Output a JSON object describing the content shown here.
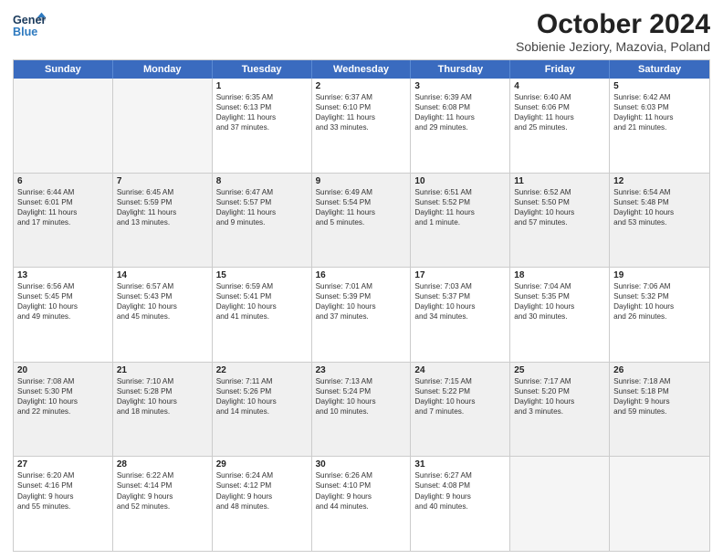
{
  "header": {
    "logo_line1": "General",
    "logo_line2": "Blue",
    "title": "October 2024",
    "subtitle": "Sobienie Jeziory, Mazovia, Poland"
  },
  "days": [
    "Sunday",
    "Monday",
    "Tuesday",
    "Wednesday",
    "Thursday",
    "Friday",
    "Saturday"
  ],
  "weeks": [
    [
      {
        "day": "",
        "info": [],
        "empty": true
      },
      {
        "day": "",
        "info": [],
        "empty": true
      },
      {
        "day": "1",
        "info": [
          "Sunrise: 6:35 AM",
          "Sunset: 6:13 PM",
          "Daylight: 11 hours",
          "and 37 minutes."
        ],
        "empty": false
      },
      {
        "day": "2",
        "info": [
          "Sunrise: 6:37 AM",
          "Sunset: 6:10 PM",
          "Daylight: 11 hours",
          "and 33 minutes."
        ],
        "empty": false
      },
      {
        "day": "3",
        "info": [
          "Sunrise: 6:39 AM",
          "Sunset: 6:08 PM",
          "Daylight: 11 hours",
          "and 29 minutes."
        ],
        "empty": false
      },
      {
        "day": "4",
        "info": [
          "Sunrise: 6:40 AM",
          "Sunset: 6:06 PM",
          "Daylight: 11 hours",
          "and 25 minutes."
        ],
        "empty": false
      },
      {
        "day": "5",
        "info": [
          "Sunrise: 6:42 AM",
          "Sunset: 6:03 PM",
          "Daylight: 11 hours",
          "and 21 minutes."
        ],
        "empty": false
      }
    ],
    [
      {
        "day": "6",
        "info": [
          "Sunrise: 6:44 AM",
          "Sunset: 6:01 PM",
          "Daylight: 11 hours",
          "and 17 minutes."
        ],
        "empty": false
      },
      {
        "day": "7",
        "info": [
          "Sunrise: 6:45 AM",
          "Sunset: 5:59 PM",
          "Daylight: 11 hours",
          "and 13 minutes."
        ],
        "empty": false
      },
      {
        "day": "8",
        "info": [
          "Sunrise: 6:47 AM",
          "Sunset: 5:57 PM",
          "Daylight: 11 hours",
          "and 9 minutes."
        ],
        "empty": false
      },
      {
        "day": "9",
        "info": [
          "Sunrise: 6:49 AM",
          "Sunset: 5:54 PM",
          "Daylight: 11 hours",
          "and 5 minutes."
        ],
        "empty": false
      },
      {
        "day": "10",
        "info": [
          "Sunrise: 6:51 AM",
          "Sunset: 5:52 PM",
          "Daylight: 11 hours",
          "and 1 minute."
        ],
        "empty": false
      },
      {
        "day": "11",
        "info": [
          "Sunrise: 6:52 AM",
          "Sunset: 5:50 PM",
          "Daylight: 10 hours",
          "and 57 minutes."
        ],
        "empty": false
      },
      {
        "day": "12",
        "info": [
          "Sunrise: 6:54 AM",
          "Sunset: 5:48 PM",
          "Daylight: 10 hours",
          "and 53 minutes."
        ],
        "empty": false
      }
    ],
    [
      {
        "day": "13",
        "info": [
          "Sunrise: 6:56 AM",
          "Sunset: 5:45 PM",
          "Daylight: 10 hours",
          "and 49 minutes."
        ],
        "empty": false
      },
      {
        "day": "14",
        "info": [
          "Sunrise: 6:57 AM",
          "Sunset: 5:43 PM",
          "Daylight: 10 hours",
          "and 45 minutes."
        ],
        "empty": false
      },
      {
        "day": "15",
        "info": [
          "Sunrise: 6:59 AM",
          "Sunset: 5:41 PM",
          "Daylight: 10 hours",
          "and 41 minutes."
        ],
        "empty": false
      },
      {
        "day": "16",
        "info": [
          "Sunrise: 7:01 AM",
          "Sunset: 5:39 PM",
          "Daylight: 10 hours",
          "and 37 minutes."
        ],
        "empty": false
      },
      {
        "day": "17",
        "info": [
          "Sunrise: 7:03 AM",
          "Sunset: 5:37 PM",
          "Daylight: 10 hours",
          "and 34 minutes."
        ],
        "empty": false
      },
      {
        "day": "18",
        "info": [
          "Sunrise: 7:04 AM",
          "Sunset: 5:35 PM",
          "Daylight: 10 hours",
          "and 30 minutes."
        ],
        "empty": false
      },
      {
        "day": "19",
        "info": [
          "Sunrise: 7:06 AM",
          "Sunset: 5:32 PM",
          "Daylight: 10 hours",
          "and 26 minutes."
        ],
        "empty": false
      }
    ],
    [
      {
        "day": "20",
        "info": [
          "Sunrise: 7:08 AM",
          "Sunset: 5:30 PM",
          "Daylight: 10 hours",
          "and 22 minutes."
        ],
        "empty": false
      },
      {
        "day": "21",
        "info": [
          "Sunrise: 7:10 AM",
          "Sunset: 5:28 PM",
          "Daylight: 10 hours",
          "and 18 minutes."
        ],
        "empty": false
      },
      {
        "day": "22",
        "info": [
          "Sunrise: 7:11 AM",
          "Sunset: 5:26 PM",
          "Daylight: 10 hours",
          "and 14 minutes."
        ],
        "empty": false
      },
      {
        "day": "23",
        "info": [
          "Sunrise: 7:13 AM",
          "Sunset: 5:24 PM",
          "Daylight: 10 hours",
          "and 10 minutes."
        ],
        "empty": false
      },
      {
        "day": "24",
        "info": [
          "Sunrise: 7:15 AM",
          "Sunset: 5:22 PM",
          "Daylight: 10 hours",
          "and 7 minutes."
        ],
        "empty": false
      },
      {
        "day": "25",
        "info": [
          "Sunrise: 7:17 AM",
          "Sunset: 5:20 PM",
          "Daylight: 10 hours",
          "and 3 minutes."
        ],
        "empty": false
      },
      {
        "day": "26",
        "info": [
          "Sunrise: 7:18 AM",
          "Sunset: 5:18 PM",
          "Daylight: 9 hours",
          "and 59 minutes."
        ],
        "empty": false
      }
    ],
    [
      {
        "day": "27",
        "info": [
          "Sunrise: 6:20 AM",
          "Sunset: 4:16 PM",
          "Daylight: 9 hours",
          "and 55 minutes."
        ],
        "empty": false
      },
      {
        "day": "28",
        "info": [
          "Sunrise: 6:22 AM",
          "Sunset: 4:14 PM",
          "Daylight: 9 hours",
          "and 52 minutes."
        ],
        "empty": false
      },
      {
        "day": "29",
        "info": [
          "Sunrise: 6:24 AM",
          "Sunset: 4:12 PM",
          "Daylight: 9 hours",
          "and 48 minutes."
        ],
        "empty": false
      },
      {
        "day": "30",
        "info": [
          "Sunrise: 6:26 AM",
          "Sunset: 4:10 PM",
          "Daylight: 9 hours",
          "and 44 minutes."
        ],
        "empty": false
      },
      {
        "day": "31",
        "info": [
          "Sunrise: 6:27 AM",
          "Sunset: 4:08 PM",
          "Daylight: 9 hours",
          "and 40 minutes."
        ],
        "empty": false
      },
      {
        "day": "",
        "info": [],
        "empty": true
      },
      {
        "day": "",
        "info": [],
        "empty": true
      }
    ]
  ],
  "alt_rows": [
    1,
    3
  ]
}
